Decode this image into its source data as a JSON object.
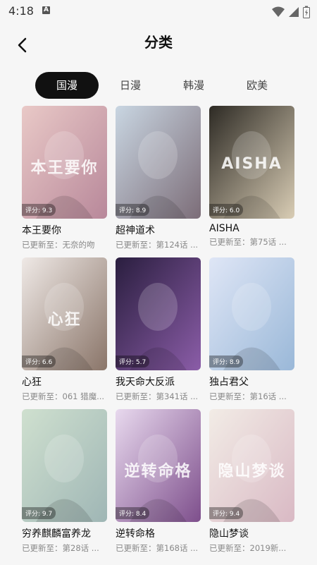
{
  "status": {
    "time": "4:18",
    "indicator": "A"
  },
  "header": {
    "title": "分类",
    "back_icon": "back-arrow-icon"
  },
  "tabs": [
    {
      "label": "国漫",
      "active": true
    },
    {
      "label": "日漫",
      "active": false
    },
    {
      "label": "韩漫",
      "active": false
    },
    {
      "label": "欧美",
      "active": false
    }
  ],
  "comics": [
    {
      "title": "本王要你",
      "rating": "评分: 9.3",
      "update": "已更新至：无奈的吻",
      "cover_text": "本王要你",
      "colors": [
        "#e9c9c7",
        "#b8889a"
      ]
    },
    {
      "title": "超神道术",
      "rating": "评分: 8.9",
      "update": "已更新至：第124话 ...",
      "cover_text": "",
      "colors": [
        "#c9d6e2",
        "#7c6d78"
      ]
    },
    {
      "title": "AISHA",
      "rating": "评分: 6.0",
      "update": "已更新至：第75话 ...",
      "cover_text": "AISHA",
      "colors": [
        "#2d2a24",
        "#d9cdb5"
      ]
    },
    {
      "title": "心狂",
      "rating": "评分: 6.6",
      "update": "已更新至：061 猎魔...",
      "cover_text": "心狂",
      "colors": [
        "#efe9e6",
        "#8a7569"
      ]
    },
    {
      "title": "我天命大反派",
      "rating": "评分: 5.7",
      "update": "已更新至：第341话 ...",
      "cover_text": "",
      "colors": [
        "#2a1e3f",
        "#8b5da8"
      ]
    },
    {
      "title": "独占君父",
      "rating": "评分: 8.9",
      "update": "已更新至：第16话 ...",
      "cover_text": "",
      "colors": [
        "#dfe6f6",
        "#9ab8d8"
      ]
    },
    {
      "title": "穷养麒麟富养龙",
      "rating": "评分: 9.7",
      "update": "已更新至：第28话 ...",
      "cover_text": "",
      "colors": [
        "#cfe0cf",
        "#9fb6b5"
      ]
    },
    {
      "title": "逆转命格",
      "rating": "评分: 8.4",
      "update": "已更新至：第168话 ...",
      "cover_text": "逆转命格",
      "colors": [
        "#e8d9ee",
        "#7e4f8c"
      ]
    },
    {
      "title": "隐山梦谈",
      "rating": "评分: 9.4",
      "update": "已更新至：2019新...",
      "cover_text": "隐山梦谈",
      "colors": [
        "#f2ece6",
        "#d9b9c4"
      ]
    }
  ]
}
